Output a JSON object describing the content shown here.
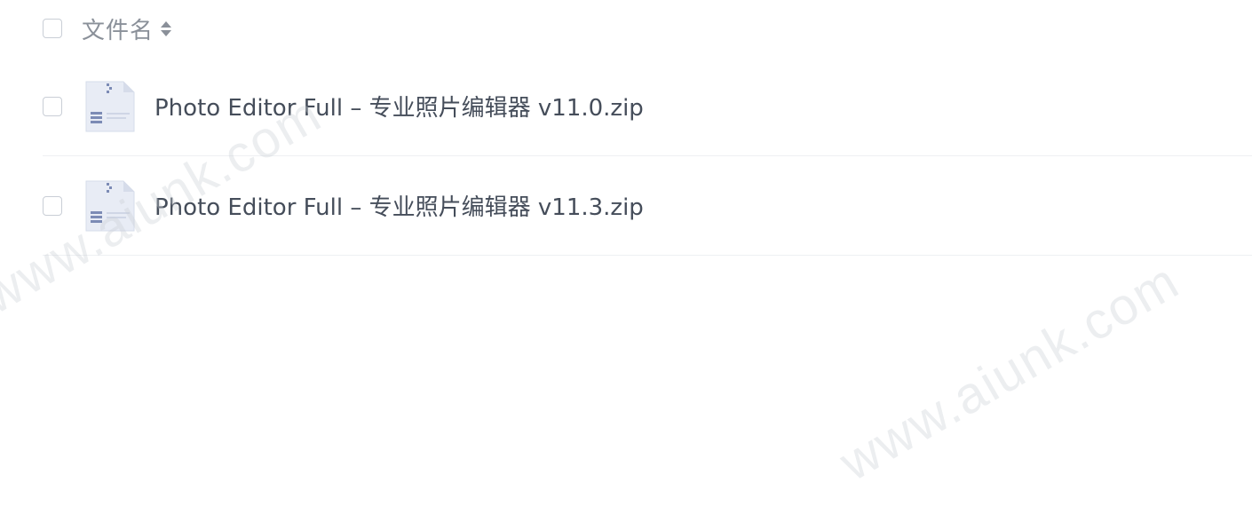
{
  "header": {
    "column_title": "文件名",
    "sort_icon": "sort-both-icon"
  },
  "files": [
    {
      "name": "Photo Editor Full – 专业照片编辑器 v11.0.zip",
      "icon": "zip-file-icon"
    },
    {
      "name": "Photo Editor Full – 专业照片编辑器 v11.3.zip",
      "icon": "zip-file-icon"
    }
  ],
  "watermark": "www.aiunk.com",
  "colors": {
    "text": "#454d5a",
    "header_text": "#8a9099",
    "checkbox_border": "#c9ced6",
    "icon_body": "#e8ecf5",
    "icon_accent": "#7c8bb5"
  }
}
